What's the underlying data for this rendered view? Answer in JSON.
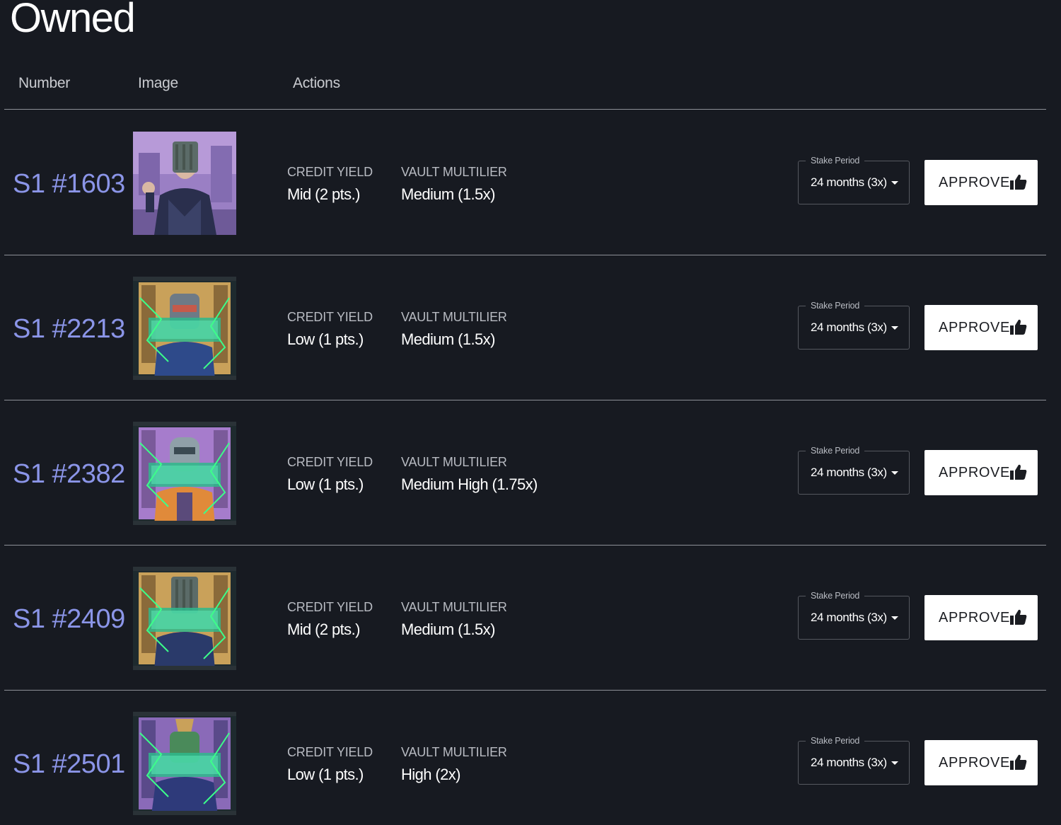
{
  "page": {
    "title": "Owned"
  },
  "table": {
    "headers": {
      "number": "Number",
      "image": "Image",
      "actions": "Actions"
    }
  },
  "rows": [
    {
      "number": "S1 #1603",
      "image_icon": "nft-character-image",
      "credit_yield_label": "CREDIT YIELD",
      "credit_yield_value": "Mid (2 pts.)",
      "vault_label": "VAULT MULTILIER",
      "vault_value": "Medium (1.5x)",
      "stake_label": "Stake Period",
      "stake_value": "24 months (3x)",
      "approve_label": "APPROVE",
      "approve_icon": "thumbs-up-icon"
    },
    {
      "number": "S1 #2213",
      "image_icon": "nft-character-image",
      "credit_yield_label": "CREDIT YIELD",
      "credit_yield_value": "Low (1 pts.)",
      "vault_label": "VAULT MULTILIER",
      "vault_value": "Medium (1.5x)",
      "stake_label": "Stake Period",
      "stake_value": "24 months (3x)",
      "approve_label": "APPROVE",
      "approve_icon": "thumbs-up-icon"
    },
    {
      "number": "S1 #2382",
      "image_icon": "nft-character-image",
      "credit_yield_label": "CREDIT YIELD",
      "credit_yield_value": "Low (1 pts.)",
      "vault_label": "VAULT MULTILIER",
      "vault_value": "Medium High (1.75x)",
      "stake_label": "Stake Period",
      "stake_value": "24 months (3x)",
      "approve_label": "APPROVE",
      "approve_icon": "thumbs-up-icon"
    },
    {
      "number": "S1 #2409",
      "image_icon": "nft-character-image",
      "credit_yield_label": "CREDIT YIELD",
      "credit_yield_value": "Mid (2 pts.)",
      "vault_label": "VAULT MULTILIER",
      "vault_value": "Medium (1.5x)",
      "stake_label": "Stake Period",
      "stake_value": "24 months (3x)",
      "approve_label": "APPROVE",
      "approve_icon": "thumbs-up-icon"
    },
    {
      "number": "S1 #2501",
      "image_icon": "nft-character-image",
      "credit_yield_label": "CREDIT YIELD",
      "credit_yield_value": "Low (1 pts.)",
      "vault_label": "VAULT MULTILIER",
      "vault_value": "High (2x)",
      "stake_label": "Stake Period",
      "stake_value": "24 months (3x)",
      "approve_label": "APPROVE",
      "approve_icon": "thumbs-up-icon"
    }
  ],
  "colors": {
    "background": "#171a21",
    "number_accent": "#8b95e8",
    "divider": "#8d9097",
    "button_bg": "#ffffff"
  }
}
